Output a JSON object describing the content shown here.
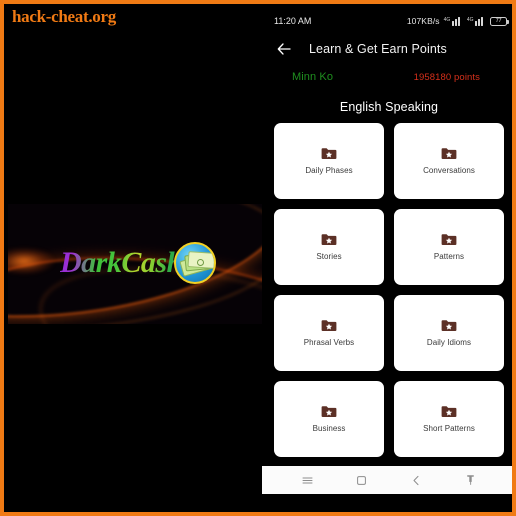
{
  "watermark": {
    "text": "hack-cheat.org"
  },
  "promo": {
    "logo_text": "DarkCash",
    "badge_icon": "money-bills-icon"
  },
  "phone": {
    "statusbar": {
      "time": "11:20 AM",
      "network_speed": "107KB/s",
      "sim1_label": "4G",
      "sim2_label": "4G",
      "battery_level": "77"
    },
    "appbar": {
      "back_icon": "back-arrow-icon",
      "title": "Learn & Get Earn Points"
    },
    "user": {
      "name": "Minn Ko",
      "name_color": "#1f8f1f",
      "points": "1958180 points",
      "points_color": "#d6301b"
    },
    "section": {
      "title": "English Speaking"
    },
    "cards": [
      {
        "label": "Daily Phases",
        "icon": "folder-star-icon"
      },
      {
        "label": "Conversations",
        "icon": "folder-star-icon"
      },
      {
        "label": "Stories",
        "icon": "folder-star-icon"
      },
      {
        "label": "Patterns",
        "icon": "folder-star-icon"
      },
      {
        "label": "Phrasal Verbs",
        "icon": "folder-star-icon"
      },
      {
        "label": "Daily Idioms",
        "icon": "folder-star-icon"
      },
      {
        "label": "Business",
        "icon": "folder-star-icon"
      },
      {
        "label": "Short Patterns",
        "icon": "folder-star-icon"
      }
    ],
    "navbar": {
      "recents_icon": "menu-recents-icon",
      "home_icon": "home-square-icon",
      "back_icon": "back-chevron-icon",
      "pin_icon": "pin-icon"
    }
  },
  "theme": {
    "frame_border": "#f07a14",
    "card_bg": "#ffffff",
    "folder_icon_color": "#5c3026",
    "accent_orange": "#f07a14"
  }
}
